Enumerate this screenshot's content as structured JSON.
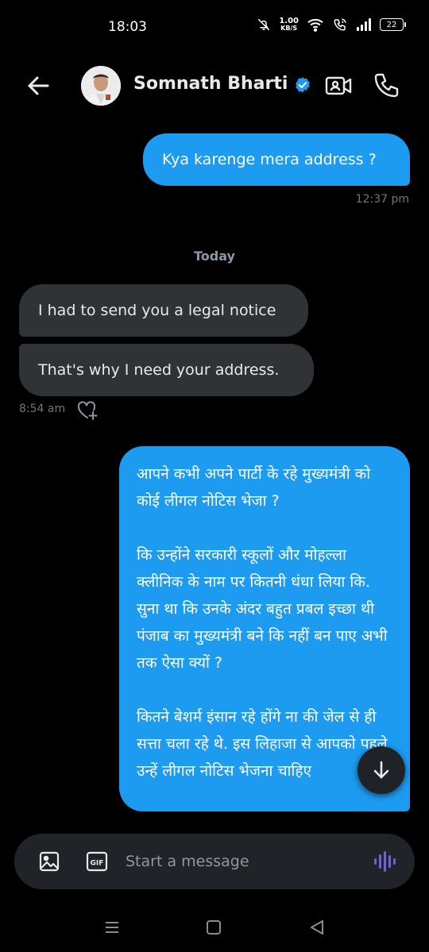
{
  "status_bar": {
    "time": "18:03",
    "net_speed_value": "1.00",
    "net_speed_unit": "KB/S",
    "battery": "22",
    "icons": [
      "mute-icon",
      "wifi-icon",
      "wifi-calling-icon",
      "signal-icon",
      "battery-icon"
    ]
  },
  "header": {
    "contact_name": "Somnath Bharti",
    "verified": true,
    "accent": "#1d9bf0"
  },
  "messages": [
    {
      "direction": "outgoing",
      "text": "Kya karenge mera address ?"
    },
    {
      "direction": "incoming",
      "text": "I had to send you a legal notice"
    },
    {
      "direction": "incoming",
      "text": "That's why I need your address."
    },
    {
      "direction": "outgoing",
      "paragraphs": [
        "आपने कभी अपने पार्टी के रहे मुख्यमंत्री को कोई लीगल नोटिस भेजा ?",
        "कि उन्होंने सरकारी स्कूलों और मोहल्ला क्लीनिक के नाम पर कितनी धंधा लिया कि. सुना था कि उनके अंदर बहुत प्रबल इच्छा थी पंजाब का मुख्यमंत्री बने कि नहीं बन पाए अभी तक ऐसा क्यों ?",
        "कितने बेशर्म इंसान रहे होंगे ना की जेल से ही सत्ता चला रहे थे. इस लिहाजा से आपको पहले उन्हें लीगल नोटिस भेजना चाहिए"
      ]
    }
  ],
  "timestamps": {
    "first": "12:37 pm",
    "second": "8:54 am"
  },
  "day_separator": "Today",
  "composer": {
    "placeholder": "Start a message",
    "gif_label": "GIF"
  },
  "colors": {
    "outgoing_bubble": "#1d9bf0",
    "incoming_bubble": "#2f3336",
    "background": "#000000",
    "voice_icon": "#7856ff"
  }
}
